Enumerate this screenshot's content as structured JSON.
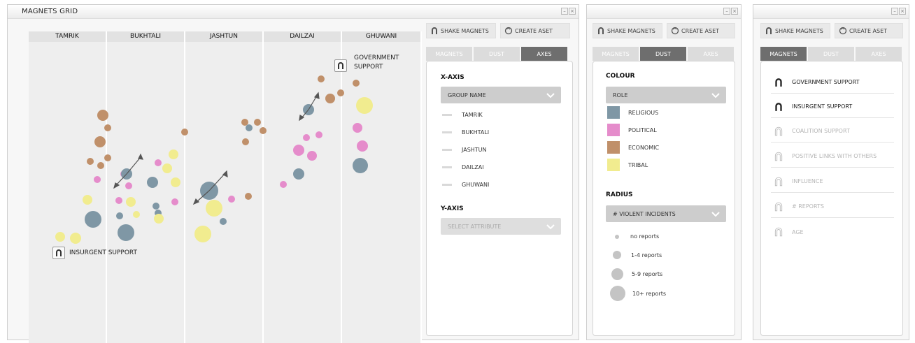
{
  "grid_panel": {
    "title": "MAGNETS GRID",
    "columns": [
      "TAMRIK",
      "BUKHTALI",
      "JASHTUN",
      "DAILZAI",
      "GHUWANI"
    ],
    "magnets": {
      "government_label_line1": "GOVERNMENT",
      "government_label_line2": "SUPPORT",
      "insurgent_label": "INSURGENT SUPPORT"
    }
  },
  "colors": {
    "religious": "#7f97a5",
    "political": "#e58ccb",
    "economic": "#c0906a",
    "tribal": "#f1ec8f"
  },
  "toolbar": {
    "shake_label": "SHAKE MAGNETS",
    "create_label": "CREATE ASET",
    "shake_label_alt": "SHAKE MAGNETS",
    "create_label_alt": "CREATE ASET",
    "shake_label_alt2": "SHAKE MAGNETS",
    "create_label_alt2": "CREATE ASET"
  },
  "tabs": {
    "magnets": "MAGNETS",
    "dust": "DUST",
    "axes": "AXES"
  },
  "axes_panel": {
    "x_axis_title": "X-AXIS",
    "x_axis_selected": "GROUP NAME",
    "x_items": [
      "TAMRIK",
      "BUKHTALI",
      "JASHTUN",
      "DAILZAI",
      "GHUWANI"
    ],
    "y_axis_title": "Y-AXIS",
    "y_axis_placeholder": "SELECT ATTRIBUTE"
  },
  "dust_panel": {
    "colour_title": "COLOUR",
    "colour_selected": "ROLE",
    "legend": [
      "RELIGIOUS",
      "POLITICAL",
      "ECONOMIC",
      "TRIBAL"
    ],
    "radius_title": "RADIUS",
    "radius_selected": "# VIOLENT INCIDENTS",
    "radius_legend": [
      "no reports",
      "1-4 reports",
      "5-9 reports",
      "10+ reports"
    ]
  },
  "magnets_panel": {
    "items": [
      "GOVERNMENT SUPPORT",
      "INSURGENT SUPPORT",
      "COALITION SUPPORT",
      "POSITIVE LINKS WITH OTHERS",
      "INFLUENCE",
      "# REPORTS",
      "AGE"
    ]
  }
}
